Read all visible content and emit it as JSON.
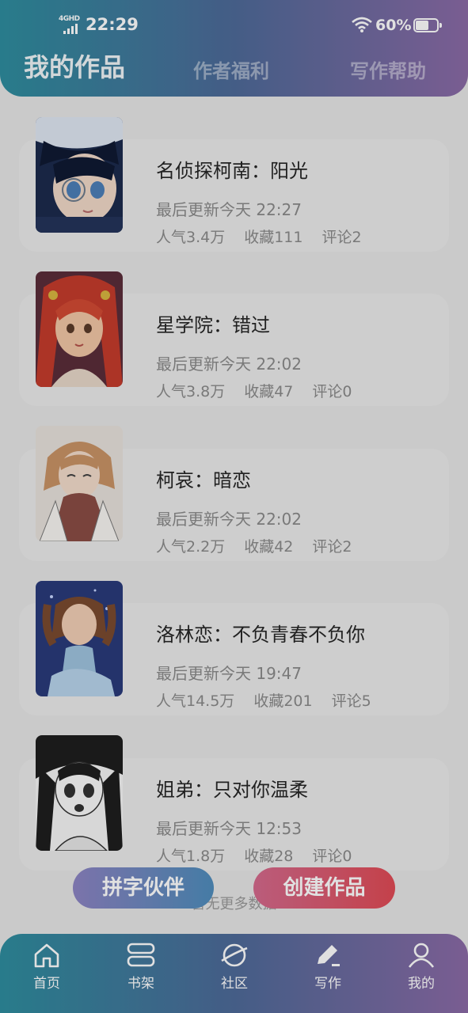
{
  "status_bar": {
    "network": "4GHD",
    "time": "22:29",
    "battery": "60%",
    "battery_level": 0.6
  },
  "tabs": [
    "我的作品",
    "作者福利",
    "写作帮助"
  ],
  "works": [
    {
      "title": "名侦探柯南：阳光",
      "updated": "最后更新今天 22:27",
      "popularity": "人气3.4万",
      "favorites": "收藏111",
      "comments": "评论2",
      "cover_colors": [
        "#1c2b4d",
        "#f1d9c8"
      ]
    },
    {
      "title": "星学院：错过",
      "updated": "最后更新今天 22:02",
      "popularity": "人气3.8万",
      "favorites": "收藏47",
      "comments": "评论0",
      "cover_colors": [
        "#5a2d3a",
        "#c43c2c"
      ]
    },
    {
      "title": "柯哀：暗恋",
      "updated": "最后更新今天 22:02",
      "popularity": "人气2.2万",
      "favorites": "收藏42",
      "comments": "评论2",
      "cover_colors": [
        "#e8e2dc",
        "#c99366"
      ]
    },
    {
      "title": "洛林恋：不负青春不负你",
      "updated": "最后更新今天 19:47",
      "popularity": "人气14.5万",
      "favorites": "收藏201",
      "comments": "评论5",
      "cover_colors": [
        "#2a3b7a",
        "#9fc3df"
      ]
    },
    {
      "title": "姐弟：只对你温柔",
      "updated": "最后更新今天 12:53",
      "popularity": "人气1.8万",
      "favorites": "收藏28",
      "comments": "评论0",
      "cover_colors": [
        "#f5f5f5",
        "#1e1e1e"
      ]
    }
  ],
  "no_more_text": "暂无更多数据",
  "buttons": {
    "partner": "拼字伙伴",
    "create": "创建作品"
  },
  "bottom_nav": [
    {
      "label": "首页",
      "icon": "home-icon"
    },
    {
      "label": "书架",
      "icon": "bookshelf-icon"
    },
    {
      "label": "社区",
      "icon": "planet-icon"
    },
    {
      "label": "写作",
      "icon": "pen-icon"
    },
    {
      "label": "我的",
      "icon": "user-icon"
    }
  ],
  "colors": {
    "header_gradient": [
      "#2e8d9f",
      "#4e6a99",
      "#8b6aa6"
    ],
    "partner_button": [
      "#8d84c3",
      "#4f8dbc"
    ],
    "create_button": [
      "#d46a8d",
      "#e04b55"
    ],
    "background": "#e6e6e6"
  }
}
